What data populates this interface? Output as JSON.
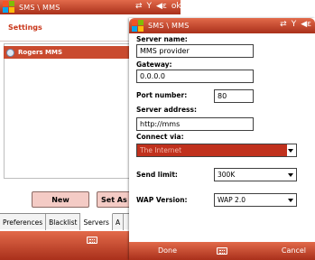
{
  "back_window": {
    "title": "SMS \\ MMS",
    "status_icons": [
      "⇄",
      "Y",
      "◀ε",
      "ok"
    ],
    "section_title": "Settings",
    "accounts": [
      {
        "label": "Rogers MMS",
        "selected": true
      }
    ],
    "buttons": {
      "new": "New",
      "set_default": "Set As D"
    },
    "tabs": [
      {
        "label": "Preferences",
        "active": false
      },
      {
        "label": "Blacklist",
        "active": false
      },
      {
        "label": "Servers",
        "active": true
      },
      {
        "label": "A",
        "active": false
      }
    ]
  },
  "front_window": {
    "title": "SMS \\ MMS",
    "status_icons": [
      "⇄",
      "Y",
      "◀ε"
    ],
    "fields": {
      "server_name_label": "Server name:",
      "server_name_value": "MMS provider",
      "gateway_label": "Gateway:",
      "gateway_value": "0.0.0.0",
      "port_label": "Port number:",
      "port_value": "80",
      "server_address_label": "Server address:",
      "server_address_value": "http://mms",
      "connect_via_label": "Connect via:",
      "connect_via_value": "The Internet",
      "send_limit_label": "Send limit:",
      "send_limit_value": "300K",
      "wap_version_label": "WAP Version:",
      "wap_version_value": "WAP 2.0"
    },
    "softkeys": {
      "left": "Done",
      "right": "Cancel"
    }
  },
  "colors": {
    "accent": "#c9361a",
    "titlebar_top": "#e26a4a",
    "titlebar_bottom": "#a9301b",
    "selection": "#c94a2e",
    "button_fill": "#f4cbc5"
  },
  "icons": [
    "windows-logo-icon",
    "connectivity-icon",
    "signal-icon",
    "volume-icon",
    "keyboard-icon",
    "account-icon",
    "dropdown-arrow-icon"
  ]
}
